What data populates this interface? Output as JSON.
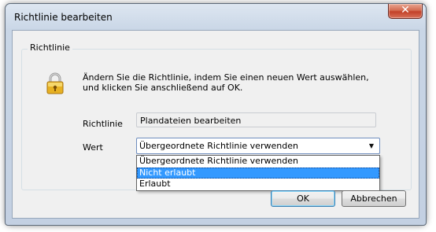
{
  "dialog": {
    "title": "Richtlinie bearbeiten",
    "close_glyph": "✕"
  },
  "group": {
    "label": "Richtlinie",
    "description": "Ändern Sie die Richtlinie, indem Sie einen neuen Wert auswählen, und klicken Sie anschließend auf OK."
  },
  "policy": {
    "label": "Richtlinie",
    "value": "Plandateien bearbeiten"
  },
  "value_field": {
    "label": "Wert",
    "selected": "Übergeordnete Richtlinie verwenden",
    "options": [
      "Übergeordnete Richtlinie verwenden",
      "Nicht erlaubt",
      "Erlaubt"
    ],
    "highlighted_option": "Nicht erlaubt"
  },
  "buttons": {
    "ok": "OK",
    "cancel": "Abbrechen"
  },
  "icons": {
    "lock": "lock-icon",
    "close": "close-icon",
    "dropdown": "chevron-down-icon"
  },
  "colors": {
    "selection": "#3399ff",
    "close_button": "#c24128"
  }
}
